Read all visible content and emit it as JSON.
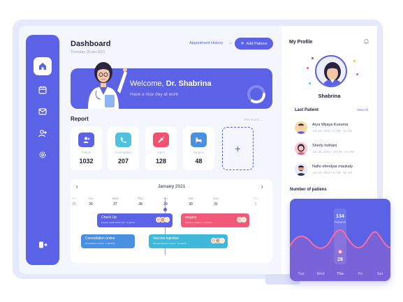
{
  "header": {
    "title": "Dashboard",
    "date": "Thursday, 26 jan 2021",
    "appointment_history": "Appontment History",
    "add_patient": "Add Patiens"
  },
  "welcome": {
    "greeting": "Welcome, ",
    "doctor": "Dr. Shabrina",
    "subtitle": "Have a nice day at work"
  },
  "report": {
    "title": "Report",
    "period": "This month",
    "cards": [
      {
        "label": "Patient",
        "value": "1032"
      },
      {
        "label": "Consultation",
        "value": "207"
      },
      {
        "label": "Inject",
        "value": "128"
      },
      {
        "label": "Surgery",
        "value": "48"
      }
    ]
  },
  "calendar": {
    "month": "January 2021",
    "days": [
      "Mo",
      "Tue",
      "Wed",
      "Thu",
      "Fri",
      "Sat",
      "Sun",
      "Mo"
    ],
    "dates": [
      "25",
      "26",
      "27",
      "28",
      "29",
      "30",
      "31",
      "1"
    ],
    "events": [
      {
        "title": "Check Up",
        "sub": "Routine health check ups - 3 patient"
      },
      {
        "title": "surgery",
        "sub": "Intensive surgery - 2 patients"
      },
      {
        "title": "Consultation online",
        "sub": "Consultation routine - 2 patients"
      },
      {
        "title": "Vaccine injection",
        "sub": "Vaccine injection routine - 3 patients"
      }
    ]
  },
  "profile": {
    "title": "My Profile",
    "name": "Shabrina",
    "last_patient_title": "Last Patient",
    "view_all": "View All",
    "patients": [
      {
        "name": "Arya Wijaya Kusuma",
        "meta": "Jan 26, 2021  •  9 AM - 11 AM"
      },
      {
        "name": "Sherly Indriani",
        "meta": "Jan 26, 2021  •  10 AM - 11 AM"
      },
      {
        "name": "Nafiu efendyar mauludy",
        "meta": "Jan 26, 2021  •  9 AM - 11 AM"
      }
    ],
    "number_title": "Number of patiens"
  },
  "chart_data": {
    "type": "area",
    "categories": [
      "Tue",
      "Wed",
      "Thu",
      "Fri",
      "Sat"
    ],
    "highlight": {
      "category": "Thu",
      "value": 134,
      "label": "Patients",
      "marker": 28
    },
    "colors": {
      "background": "#5b62e6",
      "line": "#ff6b9a"
    }
  },
  "colors": {
    "accent": "#5b62e6",
    "patient_card": "#5b62e6",
    "consultation_card": "#4fc3de",
    "inject_card": "#f0526e",
    "surgery_card": "#4a90e2",
    "event_checkup": "#5b62e6",
    "event_surgery": "#f05a78",
    "event_consultation": "#4a90e2",
    "event_vaccine": "#3fb8d9"
  }
}
